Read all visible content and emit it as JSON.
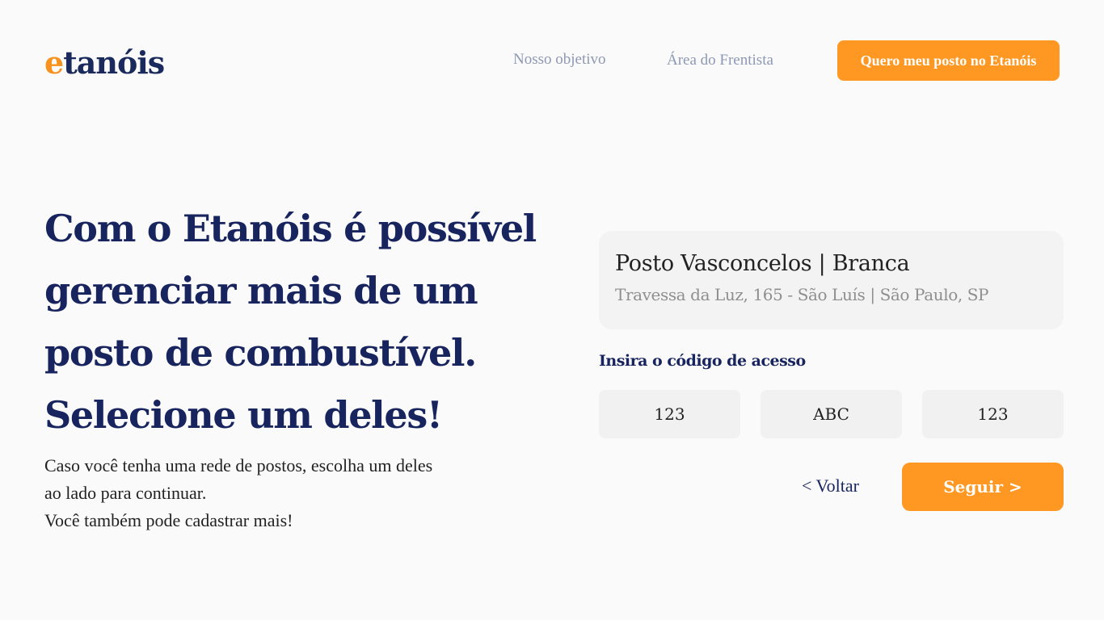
{
  "header": {
    "logo_prefix": "e",
    "logo_rest": "tanóis",
    "nav": [
      {
        "label": "Nosso objetivo"
      },
      {
        "label": "Área do Frentista"
      }
    ],
    "cta_label": "Quero meu posto no Etanóis"
  },
  "hero": {
    "headline": "Com o Etanóis é possível gerenciar mais de um posto de combustível. Selecione um deles!",
    "subtext_lines": [
      "Caso você tenha uma rede de postos, escolha um deles",
      "ao lado para continuar.",
      "Você também pode cadastrar mais!"
    ]
  },
  "station": {
    "name": "Posto Vasconcelos | Branca",
    "address": "Travessa da Luz, 165 - São Luís | São Paulo, SP"
  },
  "access_code": {
    "label": "Insira o código de acesso",
    "placeholders": [
      "123",
      "ABC",
      "123"
    ]
  },
  "actions": {
    "back_label": "< Voltar",
    "next_label": "Seguir >"
  },
  "colors": {
    "brand_navy": "#17245e",
    "brand_orange": "#fe9822",
    "background": "#fafafa"
  }
}
